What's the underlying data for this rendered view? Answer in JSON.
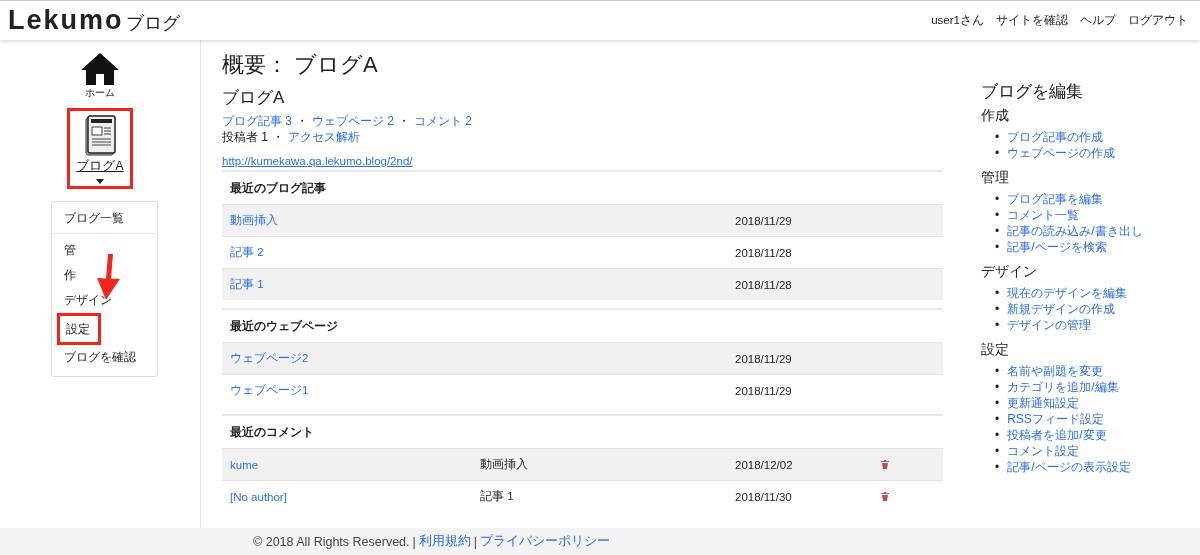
{
  "header": {
    "logo": "Lekumo",
    "logo_suffix": "ブログ",
    "nav": [
      "user1さん",
      "サイトを確認",
      "ヘルプ",
      "ログアウト"
    ]
  },
  "sidebar": {
    "home_label": "ホーム",
    "blog_label": "ブログA",
    "blog_highlighted": true,
    "menu": [
      {
        "label": "ブログ一覧",
        "divider_after": true,
        "highlighted": false
      },
      {
        "label": "管",
        "divider_after": false,
        "highlighted": false
      },
      {
        "label": "作",
        "divider_after": false,
        "highlighted": false
      },
      {
        "label": "デザイン",
        "divider_after": false,
        "highlighted": false
      },
      {
        "label": "設定",
        "divider_after": false,
        "highlighted": true
      },
      {
        "label": "ブログを確認",
        "divider_after": false,
        "highlighted": false
      }
    ]
  },
  "main": {
    "title": "概要： ブログA",
    "blog_name": "ブログA",
    "stats_lines": [
      [
        {
          "kind": "link",
          "text": "ブログ記事 3"
        },
        {
          "kind": "separator",
          "text": "・"
        },
        {
          "kind": "link",
          "text": "ウェブページ 2"
        },
        {
          "kind": "separator",
          "text": "・"
        },
        {
          "kind": "link",
          "text": "コメント 2"
        }
      ],
      [
        {
          "kind": "text",
          "text": "投稿者 1"
        },
        {
          "kind": "separator",
          "text": "・"
        },
        {
          "kind": "link",
          "text": "アクセス解析"
        }
      ]
    ],
    "url": "http://kumekawa.qa.lekumo.blog/2nd/",
    "sections": [
      {
        "title": "最近のブログ記事",
        "kind": "entries",
        "rows": [
          {
            "title": "動画挿入",
            "date": "2018/11/29"
          },
          {
            "title": "記事 2",
            "date": "2018/11/28"
          },
          {
            "title": "記事 1",
            "date": "2018/11/28"
          }
        ]
      },
      {
        "title": "最近のウェブページ",
        "kind": "entries",
        "rows": [
          {
            "title": "ウェブページ2",
            "date": "2018/11/29"
          },
          {
            "title": "ウェブページ1",
            "date": "2018/11/29"
          }
        ]
      },
      {
        "title": "最近のコメント",
        "kind": "comments",
        "rows": [
          {
            "title": "kume",
            "entry": "動画挿入",
            "date": "2018/12/02"
          },
          {
            "title": "[No author]",
            "entry": "記事 1",
            "date": "2018/11/30"
          }
        ]
      }
    ]
  },
  "edit_panel": {
    "title": "ブログを編集",
    "marker": "•",
    "groups": [
      {
        "title": "作成",
        "links": [
          "ブログ記事の作成",
          "ウェブページの作成"
        ]
      },
      {
        "title": "管理",
        "links": [
          "ブログ記事を編集",
          "コメント一覧",
          "記事の読み込み/書き出し",
          "記事/ページを検索"
        ]
      },
      {
        "title": "デザイン",
        "links": [
          "現在のデザインを編集",
          "新規デザインの作成",
          "デザインの管理"
        ]
      },
      {
        "title": "設定",
        "links": [
          "名前や副題を変更",
          "カテゴリを追加/編集",
          "更新通知設定",
          "RSSフィード設定",
          "投稿者を追加/変更",
          "コメント設定",
          "記事/ページの表示設定"
        ]
      }
    ]
  },
  "footer": [
    {
      "kind": "text",
      "text": "© 2018 All Rights Reserved."
    },
    {
      "kind": "separator",
      "text": "|"
    },
    {
      "kind": "link",
      "text": "利用規約"
    },
    {
      "kind": "separator",
      "text": "|"
    },
    {
      "kind": "link",
      "text": "プライバシーポリシー"
    }
  ]
}
